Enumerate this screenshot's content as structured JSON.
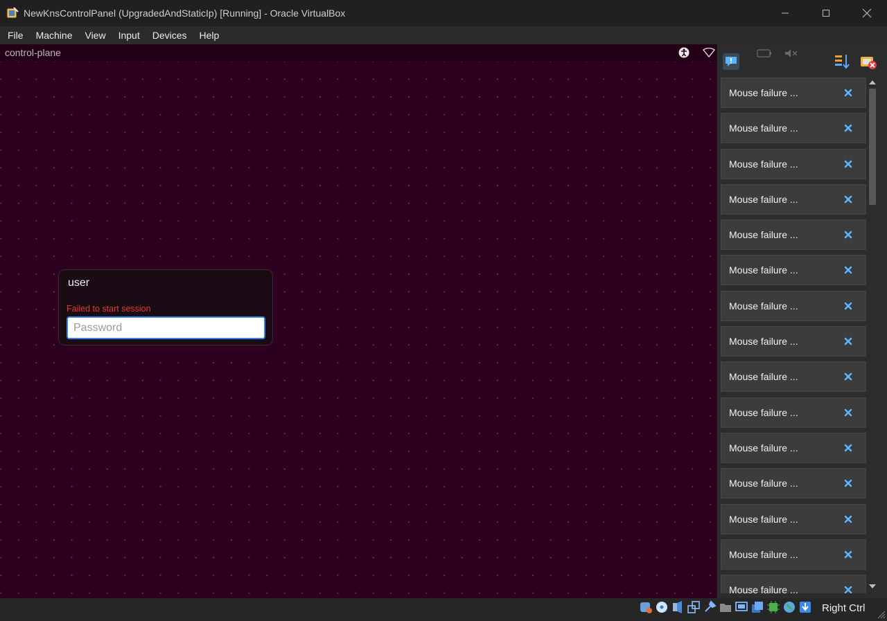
{
  "window": {
    "title": "NewKnsControlPanel (UpgradedAndStaticIp) [Running] - Oracle VirtualBox"
  },
  "menu": [
    "File",
    "Machine",
    "View",
    "Input",
    "Devices",
    "Help"
  ],
  "guest": {
    "hostname": "control-plane",
    "login": {
      "username": "user",
      "error": "Failed to start session",
      "password_placeholder": "Password"
    }
  },
  "notifications": {
    "items": [
      "Mouse failure ...",
      "Mouse failure ...",
      "Mouse failure ...",
      "Mouse failure ...",
      "Mouse failure ...",
      "Mouse failure ...",
      "Mouse failure ...",
      "Mouse failure ...",
      "Mouse failure ...",
      "Mouse failure ...",
      "Mouse failure ...",
      "Mouse failure ...",
      "Mouse failure ...",
      "Mouse failure ...",
      "Mouse failure ..."
    ]
  },
  "statusbar": {
    "host_key": "Right Ctrl"
  },
  "colors": {
    "guest_bg": "#2c001e",
    "error": "#e03c31",
    "focus": "#3584e4",
    "close_x": "#5db4ff"
  }
}
